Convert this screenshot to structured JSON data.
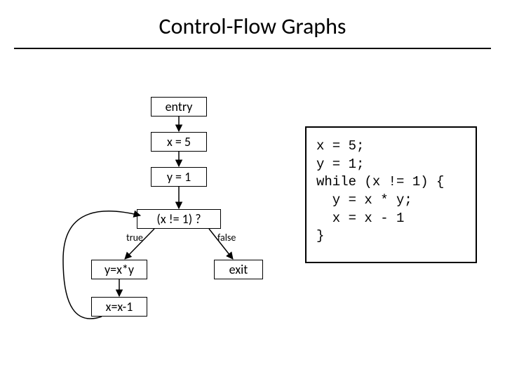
{
  "title": "Control-Flow Graphs",
  "nodes": {
    "entry": "entry",
    "x_assign": "x = 5",
    "y_assign": "y = 1",
    "cond": "(x != 1) ?",
    "y_mul": "y=x*y",
    "x_dec": "x=x-1",
    "exit": "exit"
  },
  "edge_labels": {
    "true": "true",
    "false": "false"
  },
  "code": "x = 5;\ny = 1;\nwhile (x != 1) {\n  y = x * y;\n  x = x - 1\n}"
}
